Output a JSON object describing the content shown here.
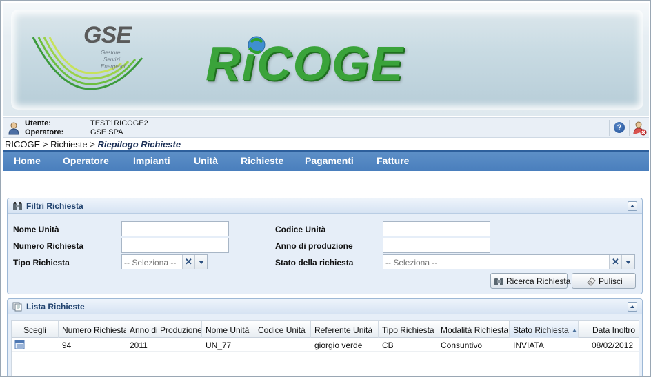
{
  "banner": {
    "gse_name": "GSE",
    "gse_tagline_1": "Gestore",
    "gse_tagline_2": "Servizi",
    "gse_tagline_3": "Energetici",
    "app_name": "RiCOGE"
  },
  "user": {
    "user_label": "Utente:",
    "user_value": "TEST1RICOGE2",
    "operator_label": "Operatore:",
    "operator_value": "GSE SPA",
    "help_label": "?"
  },
  "breadcrumb": {
    "root": "RICOGE",
    "sep1": ">",
    "middle": "Richieste",
    "sep2": ">",
    "current": "Riepilogo Richieste"
  },
  "nav": {
    "items": [
      {
        "label": "Home"
      },
      {
        "label": "Operatore"
      },
      {
        "label": "Impianti"
      },
      {
        "label": "Unità"
      },
      {
        "label": "Richieste"
      },
      {
        "label": "Pagamenti"
      },
      {
        "label": "Fatture"
      }
    ]
  },
  "filters": {
    "title": "Filtri Richiesta",
    "nome_unita_label": "Nome Unità",
    "nome_unita_value": "",
    "codice_unita_label": "Codice Unità",
    "codice_unita_value": "",
    "numero_richiesta_label": "Numero Richiesta",
    "numero_richiesta_value": "",
    "anno_produzione_label": "Anno di produzione",
    "anno_produzione_value": "",
    "tipo_richiesta_label": "Tipo Richiesta",
    "tipo_richiesta_placeholder": "-- Seleziona --",
    "stato_label": "Stato della richiesta",
    "stato_placeholder": "-- Seleziona --",
    "clear_glyph": "✕",
    "search_button": "Ricerca Richiesta",
    "clear_button": "Pulisci"
  },
  "list": {
    "title": "Lista Richieste",
    "columns": [
      "Scegli",
      "Numero Richiesta",
      "Anno di Produzione",
      "Nome Unità",
      "Codice Unità",
      "Referente Unità",
      "Tipo Richiesta",
      "Modalità Richiesta",
      "Stato Richiesta",
      "Data Inoltro"
    ],
    "sorted_column": "Stato Richiesta",
    "rows": [
      {
        "numero_richiesta": "94",
        "anno_produzione": "2011",
        "nome_unita": "UN_77",
        "codice_unita": "",
        "referente_unita": "giorgio verde",
        "tipo_richiesta": "CB",
        "modalita_richiesta": "Consuntivo",
        "stato_richiesta": "INVIATA",
        "data_inoltro": "08/02/2012"
      }
    ]
  },
  "colors": {
    "nav_bg": "#4a7fbd",
    "brand_green": "#3aa33a",
    "panel_title": "#20426e"
  }
}
